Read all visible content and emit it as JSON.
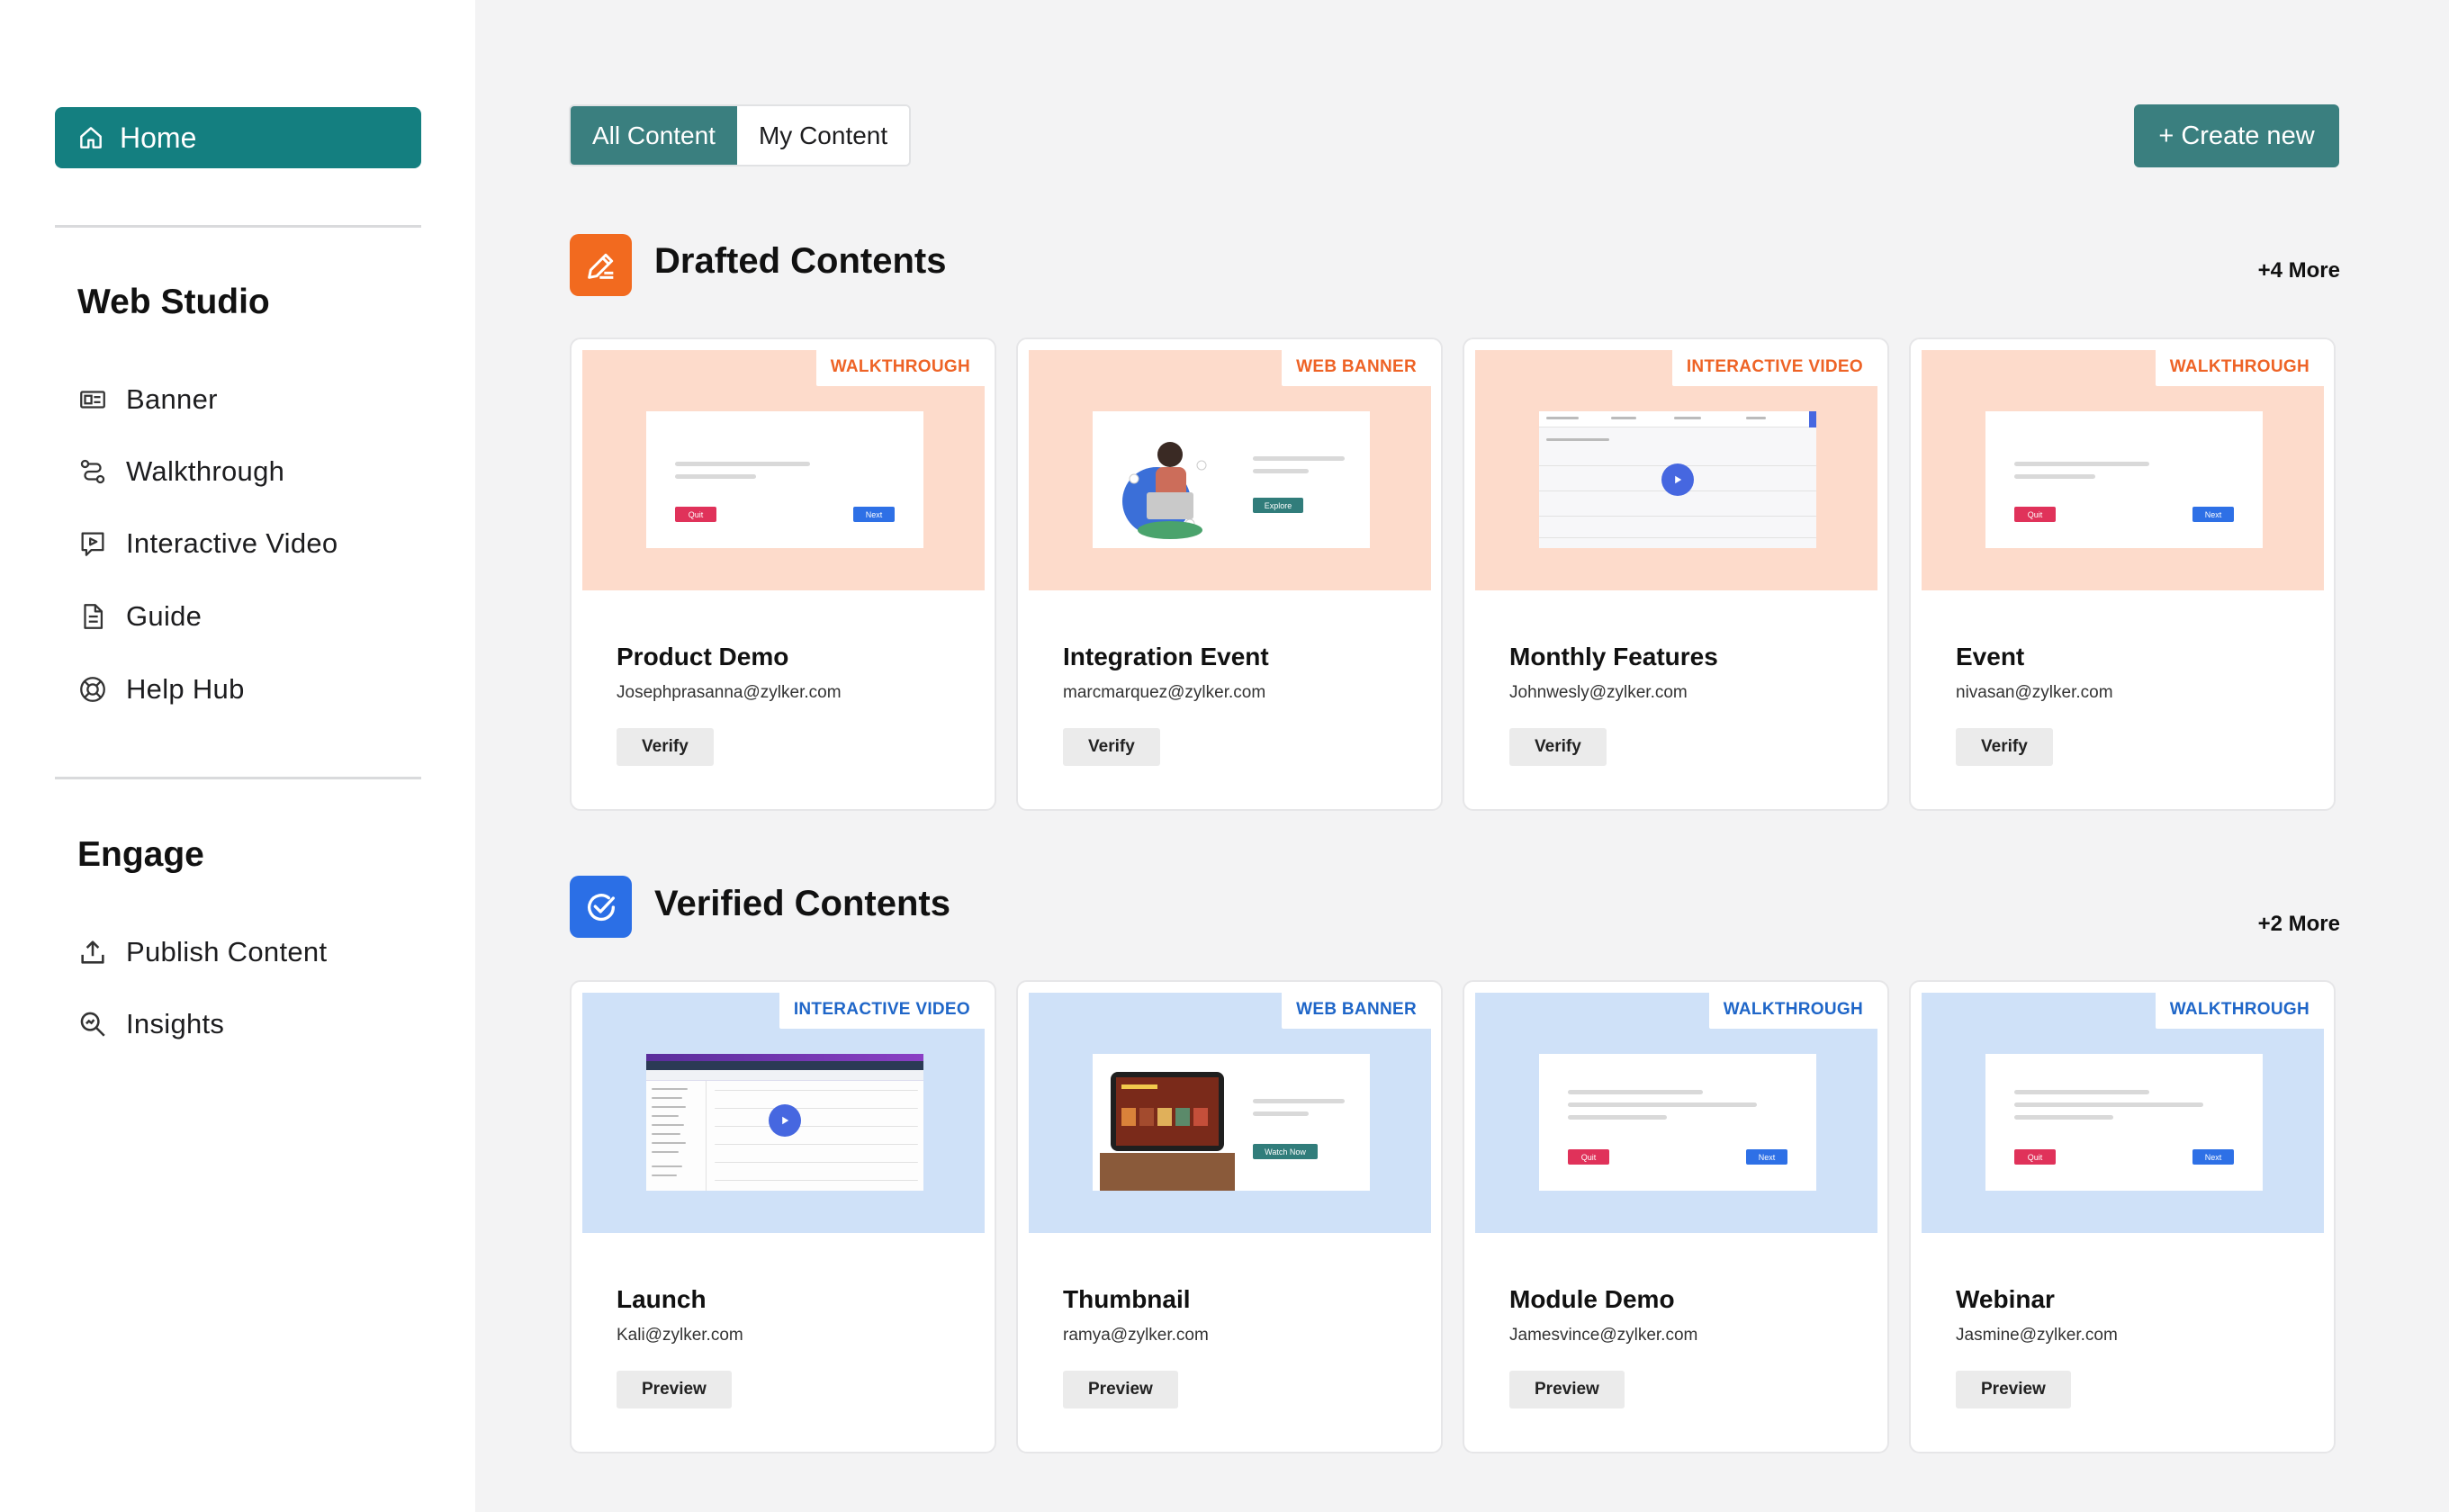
{
  "sidebar": {
    "home_label": "Home",
    "web_studio_title": "Web Studio",
    "web_studio_items": [
      {
        "label": "Banner",
        "icon": "banner-icon"
      },
      {
        "label": "Walkthrough",
        "icon": "walkthrough-icon"
      },
      {
        "label": "Interactive Video",
        "icon": "interactive-video-icon"
      },
      {
        "label": "Guide",
        "icon": "guide-icon"
      },
      {
        "label": "Help Hub",
        "icon": "help-hub-icon"
      }
    ],
    "engage_title": "Engage",
    "engage_items": [
      {
        "label": "Publish Content",
        "icon": "upload-icon"
      },
      {
        "label": "Insights",
        "icon": "insights-icon"
      }
    ]
  },
  "header": {
    "tabs": [
      "All Content",
      "My Content"
    ],
    "active_tab": "All Content",
    "create_label": "+ Create new"
  },
  "drafted": {
    "title": "Drafted Contents",
    "more": "+4 More",
    "cards": [
      {
        "tag": "WALKTHROUGH",
        "title": "Product Demo",
        "email": "Josephprasanna@zylker.com",
        "action": "Verify",
        "mock": {
          "btn1": "Quit",
          "btn2": "Next"
        }
      },
      {
        "tag": "WEB BANNER",
        "title": "Integration Event",
        "email": "marcmarquez@zylker.com",
        "action": "Verify",
        "mock": {
          "btn1": "Explore"
        }
      },
      {
        "tag": "INTERACTIVE VIDEO",
        "title": "Monthly Features",
        "email": "Johnwesly@zylker.com",
        "action": "Verify"
      },
      {
        "tag": "WALKTHROUGH",
        "title": "Event",
        "email": "nivasan@zylker.com",
        "action": "Verify",
        "mock": {
          "btn1": "Quit",
          "btn2": "Next"
        }
      }
    ]
  },
  "verified": {
    "title": "Verified Contents",
    "more": "+2 More",
    "cards": [
      {
        "tag": "INTERACTIVE VIDEO",
        "title": "Launch",
        "email": "Kali@zylker.com",
        "action": "Preview"
      },
      {
        "tag": "WEB BANNER",
        "title": "Thumbnail",
        "email": "ramya@zylker.com",
        "action": "Preview",
        "mock": {
          "btn1": "Watch Now"
        }
      },
      {
        "tag": "WALKTHROUGH",
        "title": "Module Demo",
        "email": "Jamesvince@zylker.com",
        "action": "Preview",
        "mock": {
          "btn1": "Quit",
          "btn2": "Next"
        }
      },
      {
        "tag": "WALKTHROUGH",
        "title": "Webinar",
        "email": "Jasmine@zylker.com",
        "action": "Preview",
        "mock": {
          "btn1": "Quit",
          "btn2": "Next"
        }
      }
    ]
  },
  "colors": {
    "primary": "#147f80",
    "drafted_accent": "#f26a1f",
    "verified_accent": "#2b6fe6",
    "peach_thumb": "#fddbcb",
    "blue_thumb": "#cfe1f8"
  }
}
